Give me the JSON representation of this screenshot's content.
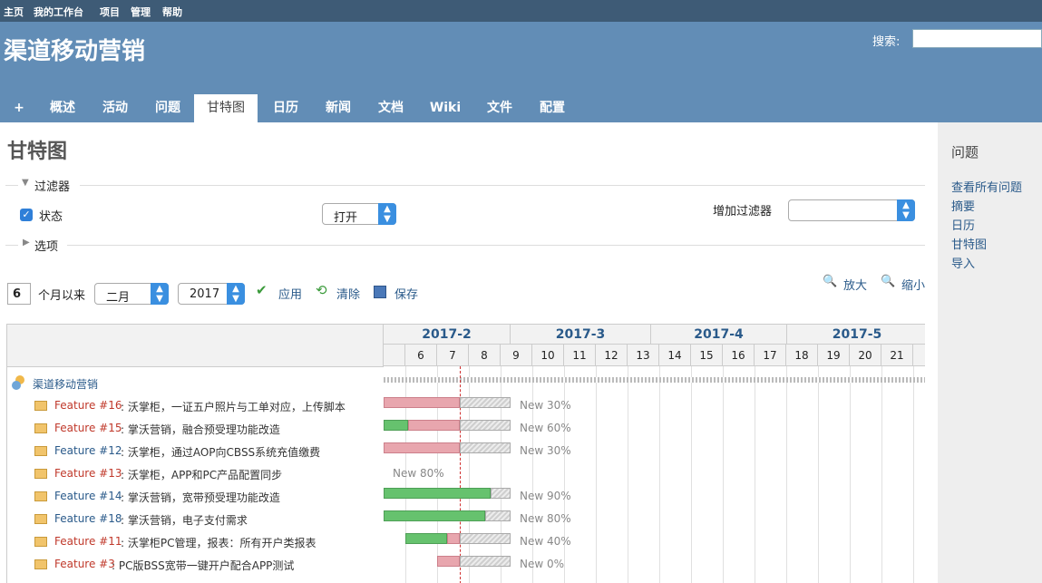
{
  "topnav": {
    "home": "主页",
    "my_page": "我的工作台",
    "projects": "项目",
    "admin": "管理",
    "help": "帮助"
  },
  "header": {
    "project": "渠道移动营销",
    "search_label": "搜索:"
  },
  "tabs": [
    {
      "label": "+"
    },
    {
      "label": "概述"
    },
    {
      "label": "活动"
    },
    {
      "label": "问题"
    },
    {
      "label": "甘特图"
    },
    {
      "label": "日历"
    },
    {
      "label": "新闻"
    },
    {
      "label": "文档"
    },
    {
      "label": "Wiki"
    },
    {
      "label": "文件"
    },
    {
      "label": "配置"
    }
  ],
  "page": {
    "title": "甘特图"
  },
  "filters": {
    "legend": "过滤器",
    "status_label": "状态",
    "status_operator": "打开",
    "add_filter_label": "增加过滤器",
    "add_filter_value": "",
    "options_legend": "选项"
  },
  "controls": {
    "months": "6",
    "months_suffix": "个月以来",
    "month_select": "二月",
    "year_select": "2017",
    "apply": "应用",
    "clear": "清除",
    "save": "保存",
    "zoom_in": "放大",
    "zoom_out": "缩小"
  },
  "gantt": {
    "months": [
      "2017-2",
      "2017-3",
      "2017-4",
      "2017-5"
    ],
    "days": [
      "6",
      "7",
      "8",
      "9",
      "10",
      "11",
      "12",
      "13",
      "14",
      "15",
      "16",
      "17",
      "18",
      "19",
      "20",
      "21"
    ],
    "project_name": "渠道移动营销",
    "issues": [
      {
        "id": "Feature #16",
        "overdue": true,
        "subject": "沃掌柜，一证五户照片与工单对应，上传脚本",
        "label": "New 30%"
      },
      {
        "id": "Feature #15",
        "overdue": true,
        "subject": "掌沃营销，融合预受理功能改造",
        "label": "New 60%"
      },
      {
        "id": "Feature #12",
        "overdue": false,
        "subject": "沃掌柜，通过AOP向CBSS系统充值缴费",
        "label": "New 30%"
      },
      {
        "id": "Feature #13",
        "overdue": true,
        "subject": "沃掌柜，APP和PC产品配置同步",
        "label": "New 80%"
      },
      {
        "id": "Feature #14",
        "overdue": false,
        "subject": "掌沃营销，宽带预受理功能改造",
        "label": "New 90%"
      },
      {
        "id": "Feature #18",
        "overdue": false,
        "subject": "掌沃营销，电子支付需求",
        "label": "New 80%"
      },
      {
        "id": "Feature #11",
        "overdue": true,
        "subject": "沃掌柜PC管理，报表：所有开户类报表",
        "label": "New 40%"
      },
      {
        "id": "Feature #3",
        "overdue": true,
        "subject": "PC版BSS宽带一键开户配合APP测试",
        "label": "New 0%"
      }
    ]
  },
  "sidebar": {
    "title": "问题",
    "links": [
      "查看所有问题",
      "摘要",
      "日历",
      "甘特图",
      "导入"
    ]
  }
}
